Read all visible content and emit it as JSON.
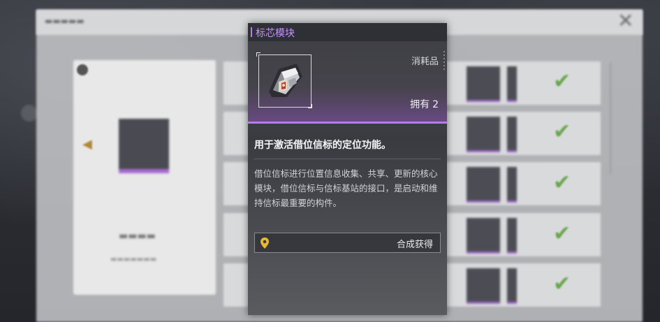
{
  "tooltip": {
    "title": "标芯模块",
    "category": "消耗品",
    "owned_label": "拥有",
    "owned_count": "2",
    "summary": "用于激活借位信标的定位功能。",
    "description": "借位信标进行位置信息收集、共享、更新的核心模块，借位信标与信标基站的接口，是启动和维持信标最重要的构件。",
    "source_label": "合成获得",
    "item_icon": "beacon-core-module-icon",
    "source_icon": "location-pin-icon"
  },
  "colors": {
    "accent_purple": "#c693ff",
    "rarity_purple": "#b77be8",
    "pin_yellow": "#e8b830",
    "check_green": "#6aa64e"
  }
}
